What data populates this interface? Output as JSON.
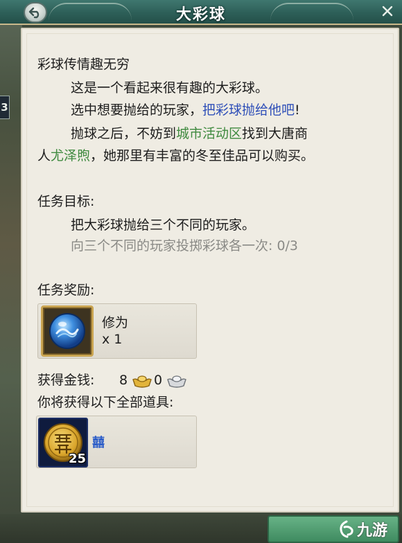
{
  "window": {
    "title": "大彩球",
    "back_icon": "back-arrow-icon",
    "close_icon": "close-icon"
  },
  "description": {
    "heading": "彩球传情趣无穷",
    "line1": "这是一个看起来很有趣的大彩球。",
    "line2_prefix": "选中想要抛给的玩家，",
    "line2_highlight": "把彩球抛给他吧",
    "line2_suffix": "!",
    "line3_prefix": "抛球之后，不妨到",
    "line3_location": "城市活动区",
    "line3_suffix": "找到大唐商",
    "line4_prefix": "人",
    "line4_npc": "尤泽煦",
    "line4_suffix": "，她那里有丰富的冬至佳品可以购买。"
  },
  "objective": {
    "label": "任务目标:",
    "text": "把大彩球抛给三个不同的玩家。",
    "progress_text": "向三个不同的玩家投掷彩球各一次: 0/3"
  },
  "reward": {
    "label": "任务奖励:",
    "item_name": "修为",
    "quantity": "x 1",
    "icon": "blue-orb-icon"
  },
  "money": {
    "label": "获得金钱:",
    "gold": "8",
    "silver": "0",
    "gold_icon": "gold-ingot-icon",
    "silver_icon": "silver-ingot-icon"
  },
  "items": {
    "label": "你将获得以下全部道具:",
    "list": [
      {
        "name": "囍",
        "count": "25",
        "icon": "double-happiness-coin-icon"
      }
    ]
  },
  "side": {
    "badge_text": "3"
  },
  "watermark": {
    "text": "九游",
    "icon": "jiuyou-logo-icon"
  },
  "colors": {
    "title_bar": "#2d5f58",
    "panel": "#efece3",
    "highlight_blue": "#2f4fb8",
    "highlight_green": "#3f8a3f",
    "muted": "#8a8a86",
    "accent_gold": "#c9a451"
  }
}
